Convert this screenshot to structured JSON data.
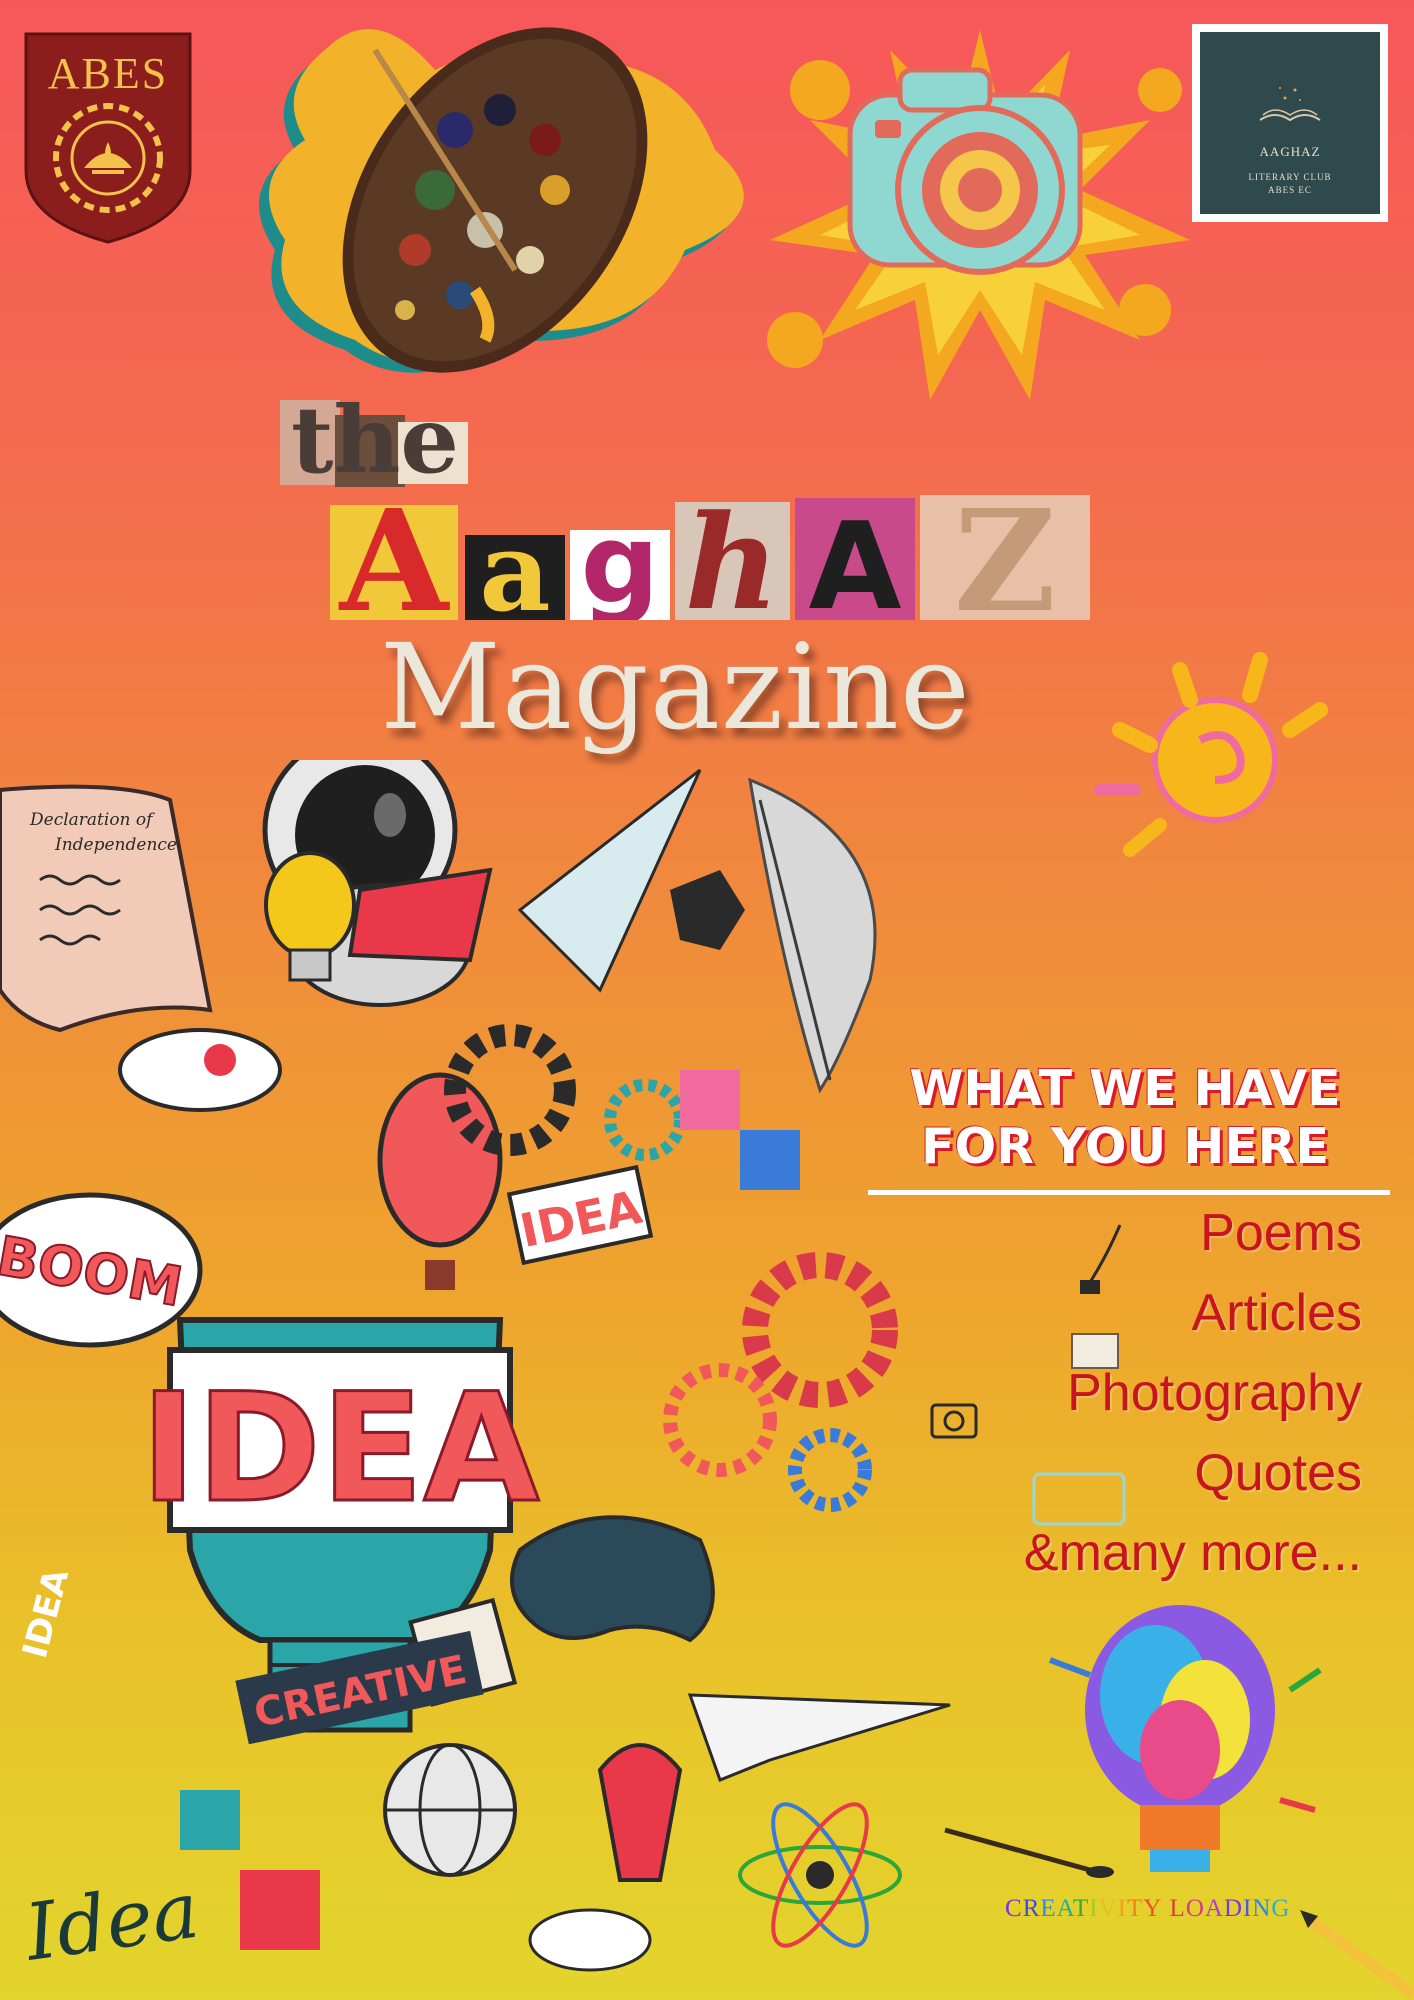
{
  "header": {
    "abes_logo_text": "ABES",
    "club_badge": {
      "name": "AAGHAZ",
      "line1": "LITERARY CLUB",
      "line2": "ABES EC"
    }
  },
  "title": {
    "the": "the",
    "aaghaz_letters": [
      "A",
      "a",
      "g",
      "h",
      "A",
      "Z"
    ],
    "magazine": "Magazine"
  },
  "illustrations": {
    "scroll_heading_1": "Declaration of",
    "scroll_heading_2": "Independence",
    "sticker_boom": "BOOM",
    "sticker_idea_small": "IDEA",
    "sticker_idea_big": "IDEA",
    "sticker_idea_side": "IDEA",
    "sticker_creative": "CREATIVE",
    "sticker_idea_script": "Idea"
  },
  "offer": {
    "heading_line1": "WHAT WE HAVE",
    "heading_line2": "FOR YOU HERE",
    "items": [
      "Poems",
      "Articles",
      "Photography",
      "Quotes",
      "&many more..."
    ]
  },
  "footer": {
    "creativity_letters": [
      "C",
      "R",
      "E",
      "A",
      "T",
      "I",
      "V",
      "I",
      "T",
      "Y",
      " ",
      "L",
      "O",
      "A",
      "D",
      "I",
      "N",
      "G"
    ],
    "creativity_colors": [
      "#8a2be2",
      "#3a4fd8",
      "#1e90ff",
      "#14b3a0",
      "#2eae3a",
      "#9ccc2c",
      "#e2c21a",
      "#f5a21a",
      "#f57f1a",
      "#ef4f2a",
      "#ffffff",
      "#e23a3a",
      "#d63a8a",
      "#b03ad6",
      "#7a3ae2",
      "#4a5ae2",
      "#2a8ae2",
      "#2ab0c8"
    ]
  },
  "colors": {
    "title_red": "#c8141e",
    "badge_bg": "#2f4a4c",
    "abes_maroon": "#8c1d1d",
    "abes_gold": "#f3c24a"
  }
}
